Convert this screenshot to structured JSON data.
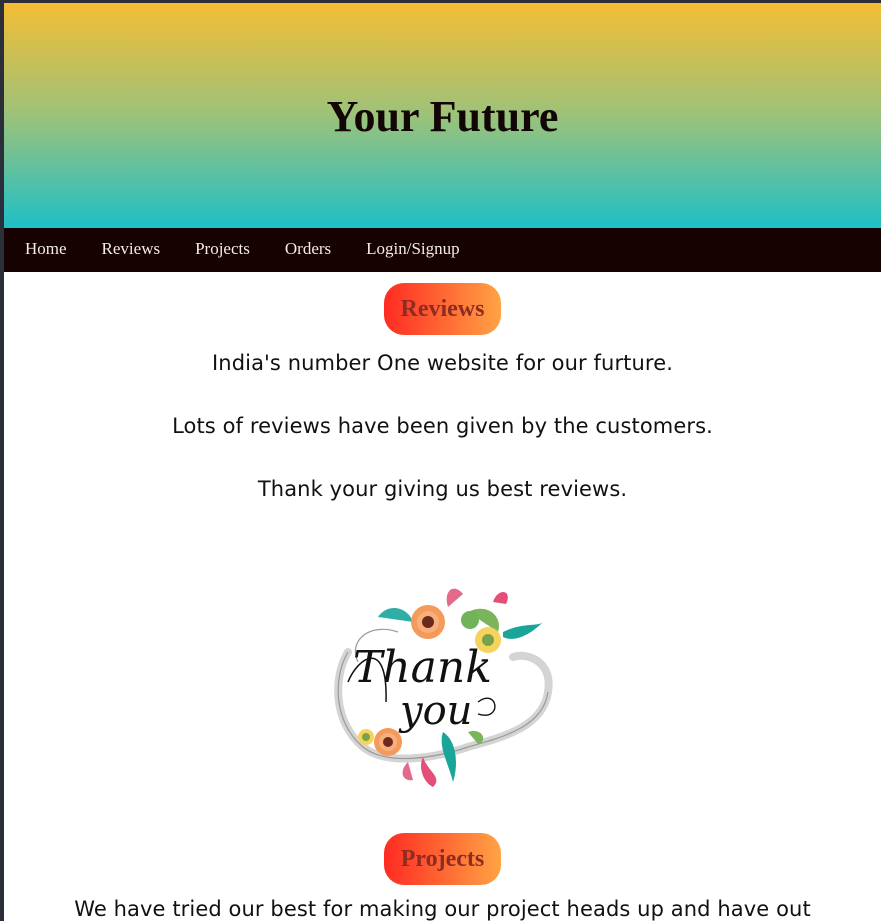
{
  "header": {
    "title": "Your Future"
  },
  "nav": {
    "items": [
      {
        "label": "Home"
      },
      {
        "label": "Reviews"
      },
      {
        "label": "Projects"
      },
      {
        "label": "Orders"
      },
      {
        "label": "Login/Signup"
      }
    ]
  },
  "reviews": {
    "heading": "Reviews",
    "lines": [
      "India's number One website for our furture.",
      "Lots of reviews have been given by the customers.",
      "Thank your giving us best reviews."
    ],
    "image_text": [
      "Thank",
      "you"
    ]
  },
  "projects": {
    "heading": "Projects",
    "partial_line": "We have tried our best for making our project heads up and have out"
  },
  "colors": {
    "hero_top": "#f4bd34",
    "hero_bottom": "#1fbfc7",
    "nav_bg": "#170202",
    "pill_start": "#ff2b22",
    "pill_end": "#ffa344"
  }
}
